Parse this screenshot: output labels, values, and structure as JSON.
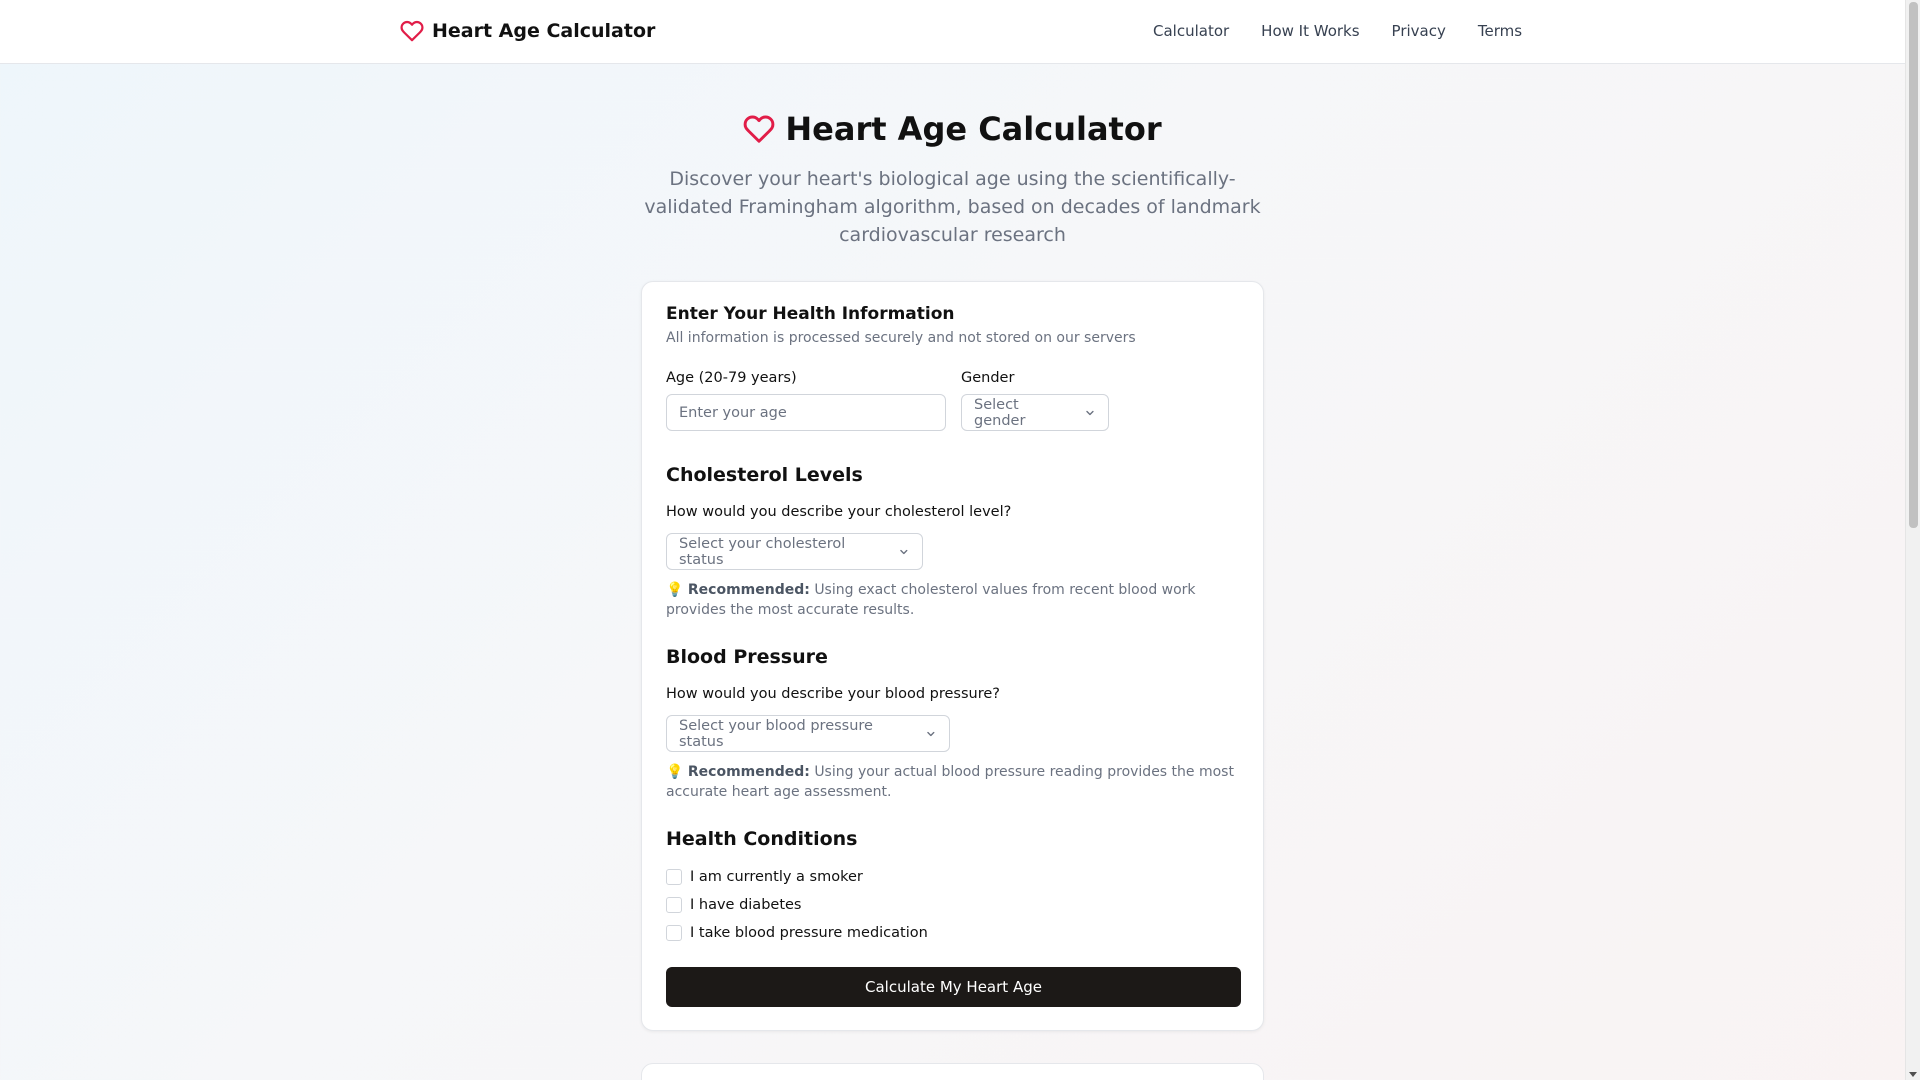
{
  "header": {
    "brand": "Heart Age Calculator",
    "nav": [
      "Calculator",
      "How It Works",
      "Privacy",
      "Terms"
    ]
  },
  "hero": {
    "title": "Heart Age Calculator",
    "subtitle": "Discover your heart's biological age using the scientifically-validated Framingham algorithm, based on decades of landmark cardiovascular research"
  },
  "form": {
    "title": "Enter Your Health Information",
    "description": "All information is processed securely and not stored on our servers",
    "age": {
      "label": "Age (20-79 years)",
      "placeholder": "Enter your age"
    },
    "gender": {
      "label": "Gender",
      "selected": "Select gender"
    },
    "cholesterol": {
      "section_title": "Cholesterol Levels",
      "question": "How would you describe your cholesterol level?",
      "selected": "Select your cholesterol status",
      "tip_icon": "💡",
      "tip_strong": "Recommended:",
      "tip_text": "Using exact cholesterol values from recent blood work provides the most accurate results."
    },
    "blood_pressure": {
      "section_title": "Blood Pressure",
      "question": "How would you describe your blood pressure?",
      "selected": "Select your blood pressure status",
      "tip_icon": "💡",
      "tip_strong": "Recommended:",
      "tip_text": "Using your actual blood pressure reading provides the most accurate heart age assessment."
    },
    "conditions": {
      "section_title": "Health Conditions",
      "items": [
        "I am currently a smoker",
        "I have diabetes",
        "I take blood pressure medication"
      ]
    },
    "submit_label": "Calculate My Heart Age"
  },
  "colors": {
    "brand_red": "#e11d48",
    "button_dark": "#1c1917",
    "muted_text": "#6b7280"
  },
  "icons": {
    "brand": "heart-icon",
    "select": "chevron-down-icon"
  }
}
